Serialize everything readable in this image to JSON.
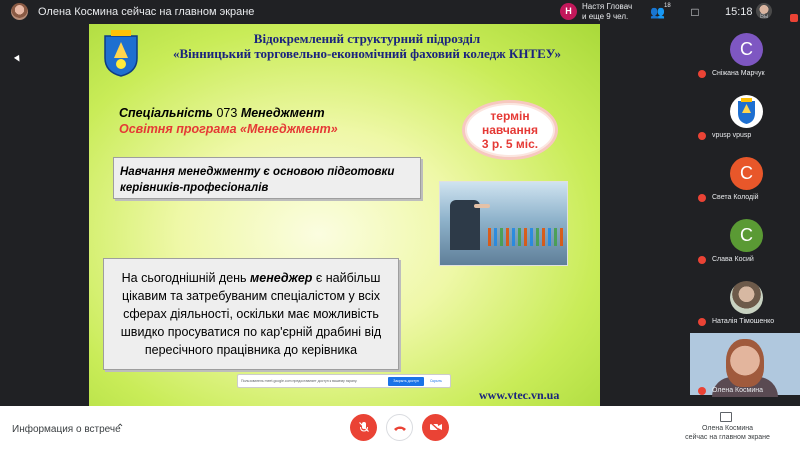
{
  "topbar": {
    "presenter_title": "Олена Космина сейчас на главном экране",
    "notification_badge": "Н",
    "notification_line1": "Настя Гловач",
    "notification_line2": "и еще 9 чел.",
    "people_count": "18",
    "clock": "15:18",
    "me_label": "Вы"
  },
  "slide": {
    "header_line1": "Відокремлений структурний підрозділ",
    "header_line2": "«Вінницький торговельно-економічний фаховий коледж КНТЕУ»",
    "spec_label": "Спеціальність",
    "spec_num": "073",
    "spec_name": "Менеджмент",
    "program": "Освітня програма «Менеджмент»",
    "term_line1": "термін",
    "term_line2": "навчання",
    "term_line3": "3 р. 5 міс.",
    "box1_text": "Навчання менеджменту є основою підготовки керівників-професіоналів",
    "box2_part1": "На сьогоднішній день ",
    "box2_emph": "менеджер",
    "box2_part2": " є найбільш цікавим та затребуваним спеціалістом у всіх сферах діяльності, оскільки має можливість швидко просуватися по кар'єрній драбині від пересічного працівника до керівника",
    "share_text": "Пользователь meet.google.com предоставляет доступ к вашему экрану.",
    "share_stop": "Закрыть доступ",
    "share_hide": "Скрыть",
    "url": "www.vtec.vn.ua"
  },
  "participants": [
    {
      "initial": "С",
      "name": "Сніжана Марчук",
      "color": "#7e57c2"
    },
    {
      "initial": "",
      "name": "vpusp vpusp",
      "color": "#ffffff"
    },
    {
      "initial": "С",
      "name": "Света Колодій",
      "color": "#e8572a"
    },
    {
      "initial": "С",
      "name": "Слава Косий",
      "color": "#5a9a34"
    },
    {
      "initial": "",
      "name": "Наталія Тімошенко",
      "color": "#8d6e63"
    },
    {
      "initial": "",
      "name": "Олена Космина",
      "color": "#b0c8de"
    }
  ],
  "bottombar": {
    "meeting_info": "Информация о встрече",
    "present_line1": "Олена Космина",
    "present_line2": "сейчас на главном экране"
  }
}
